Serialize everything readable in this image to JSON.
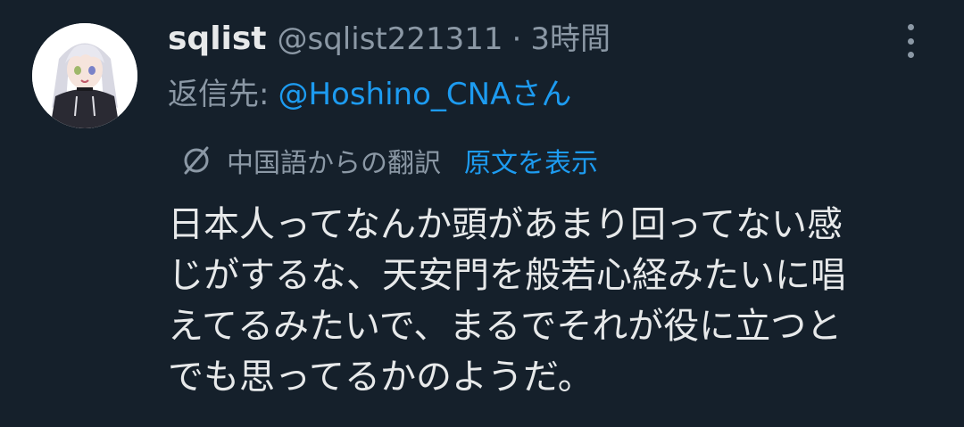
{
  "tweet": {
    "display_name": "sqlist",
    "handle": "@sqlist221311",
    "separator": "·",
    "time": "3時間",
    "reply_prefix": "返信先:",
    "reply_to": "@Hoshino_CNAさん",
    "translation_note": "中国語からの翻訳",
    "show_original": "原文を表示",
    "body_lines": [
      "日本人ってなんか頭があまり回ってない感",
      "じがするな、天安門を般若心経みたいに唱",
      "えてるみたいで、まるでそれが役に立つと",
      "でも思ってるかのようだ。"
    ]
  },
  "icons": {
    "more": "more-vertical-icon",
    "translate": "translate-icon",
    "avatar": "anime-avatar"
  },
  "colors": {
    "background": "#15202b",
    "text_primary": "#e7e9ea",
    "text_secondary": "#8b98a5",
    "accent": "#1d9bf0"
  }
}
